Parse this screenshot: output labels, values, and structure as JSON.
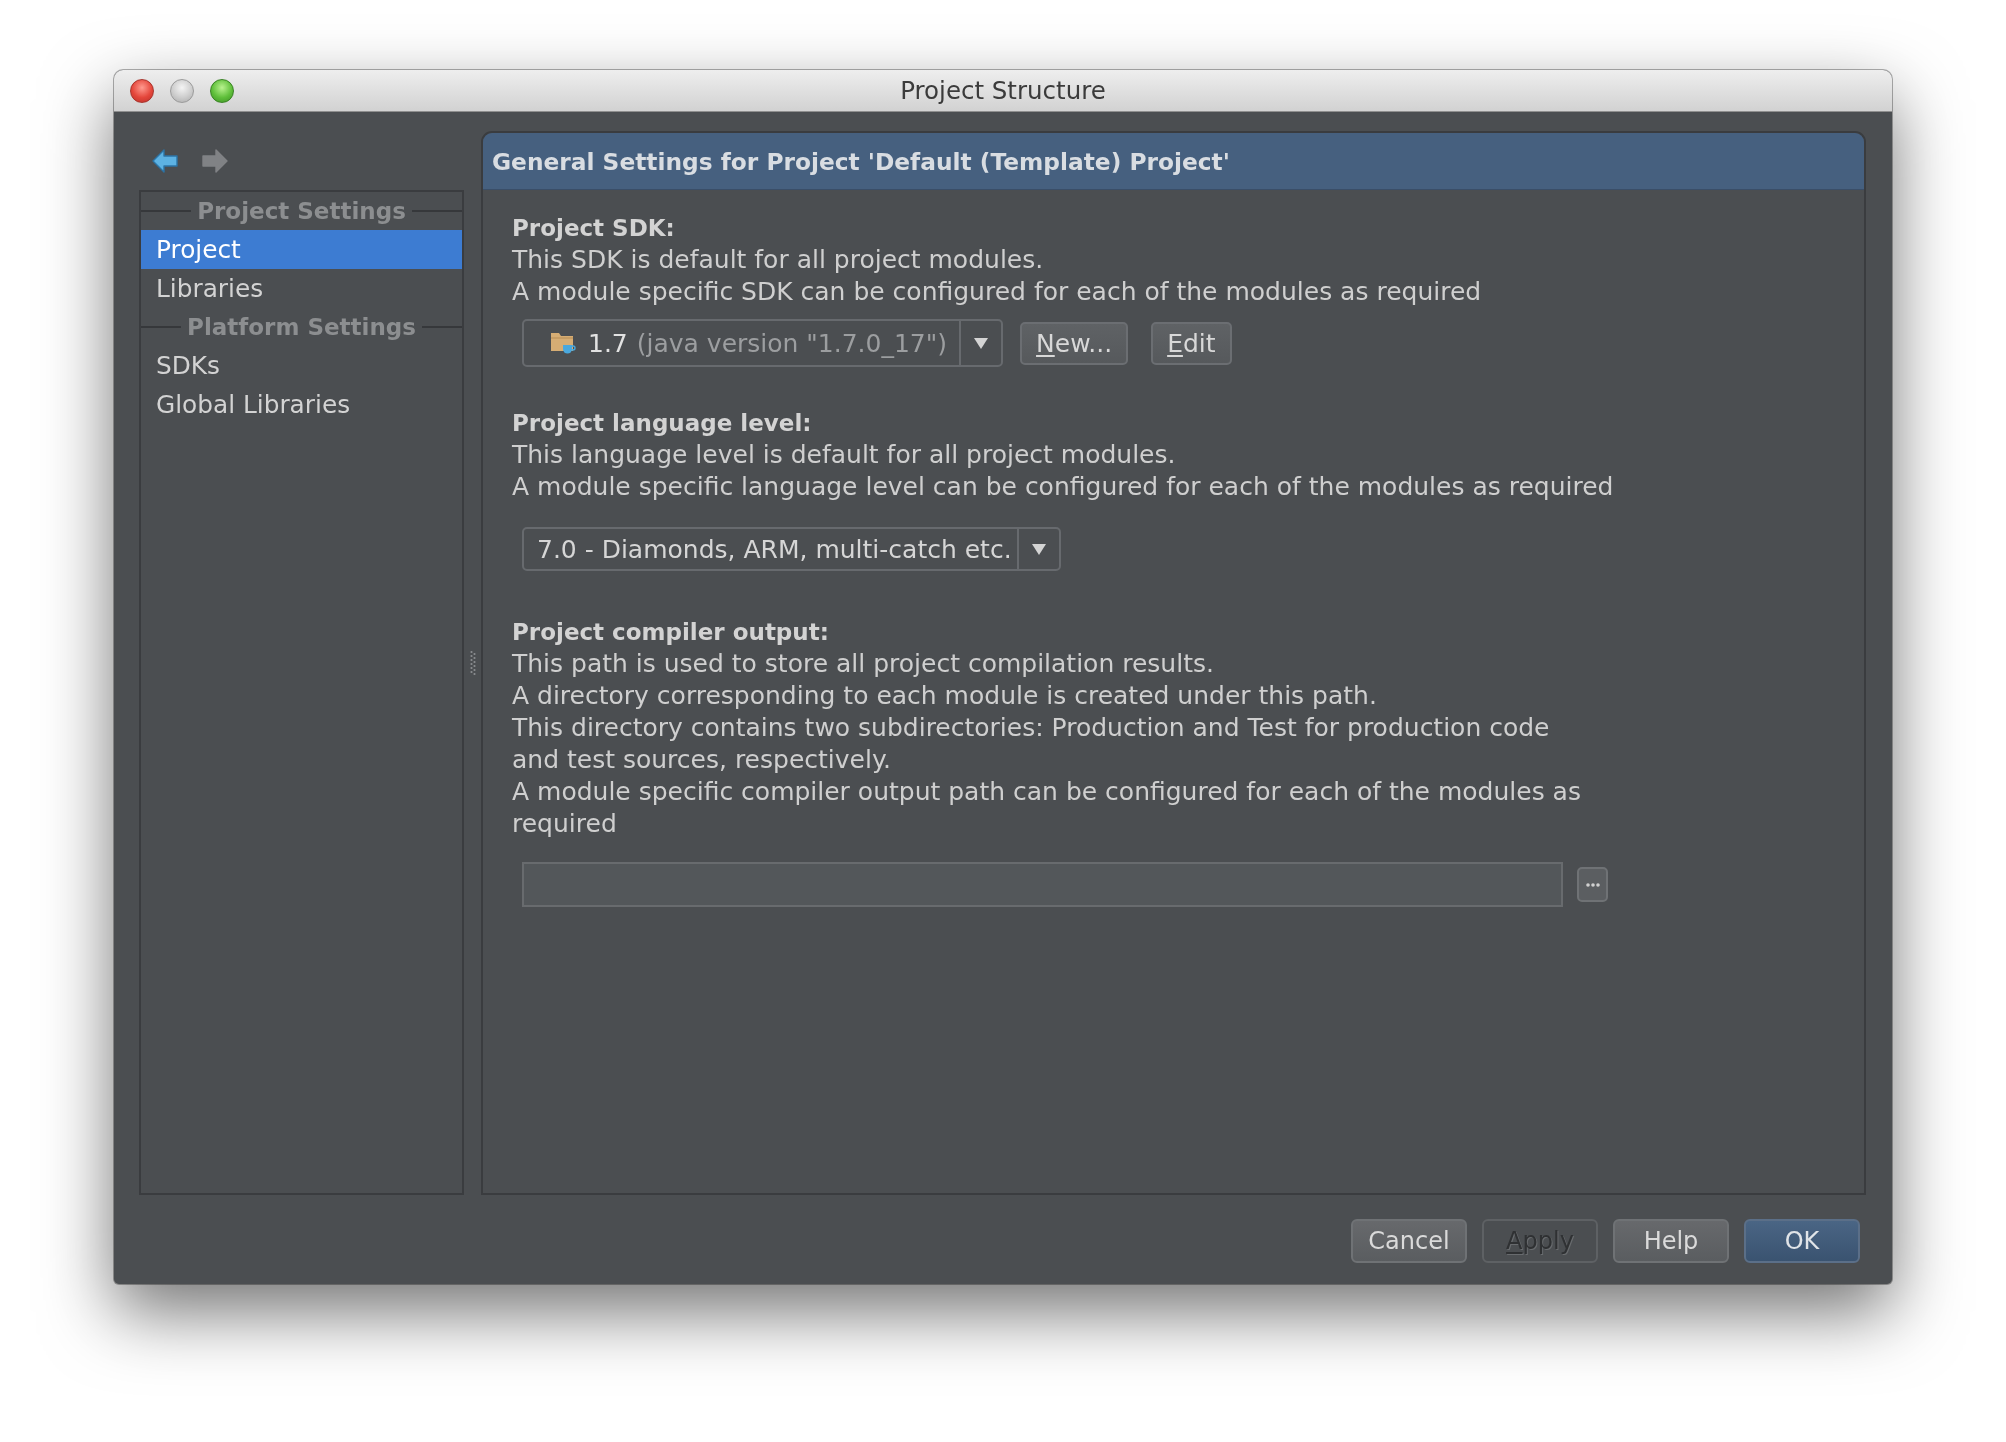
{
  "window": {
    "title": "Project Structure",
    "controls": [
      {
        "kind": "close",
        "disabled": false
      },
      {
        "kind": "minimize",
        "disabled": true
      },
      {
        "kind": "zoom",
        "disabled": false
      }
    ]
  },
  "navigation": [
    {
      "kind": "back",
      "disabled": false
    },
    {
      "kind": "forward",
      "disabled": true
    }
  ],
  "sidebar": {
    "sections": [
      {
        "title": "Project Settings",
        "items": [
          {
            "label": "Project",
            "selected": true
          },
          {
            "label": "Libraries",
            "selected": false
          }
        ]
      },
      {
        "title": "Platform Settings",
        "items": [
          {
            "label": "SDKs",
            "selected": false
          },
          {
            "label": "Global Libraries",
            "selected": false
          }
        ]
      }
    ]
  },
  "panel": {
    "title": "General Settings for Project 'Default (Template) Project'",
    "sdk": {
      "heading": "Project SDK:",
      "description": "This SDK is default for all project modules.\nA module specific SDK can be configured for each of the modules as required",
      "dropdown": {
        "value": "1.7",
        "detail": "(java version \"1.7.0_17\")"
      },
      "buttons": [
        {
          "label": "New...",
          "mnemonic": true
        },
        {
          "label": "Edit",
          "mnemonic": true
        }
      ]
    },
    "language_level": {
      "heading": "Project language level:",
      "description": "This language level is default for all project modules.\nA module specific language level can be configured for each of the modules as required",
      "dropdown": {
        "value": "7.0 - Diamonds, ARM, multi-catch etc."
      }
    },
    "compiler_output": {
      "heading": "Project compiler output:",
      "description": "This path is used to store all project compilation results.\nA directory corresponding to each module is created under this path.\nThis directory contains two subdirectories: Production and Test for production code\nand test sources, respectively.\nA module specific compiler output path can be configured for each of the modules as\nrequired"
    }
  },
  "buttons": [
    {
      "label": "Cancel",
      "disabled": false,
      "default": false,
      "mnemonic": false
    },
    {
      "label": "Apply",
      "disabled": true,
      "default": false,
      "mnemonic": true
    },
    {
      "label": "Help",
      "disabled": false,
      "default": false,
      "mnemonic": false
    },
    {
      "label": "OK",
      "disabled": false,
      "default": true,
      "mnemonic": false
    }
  ]
}
